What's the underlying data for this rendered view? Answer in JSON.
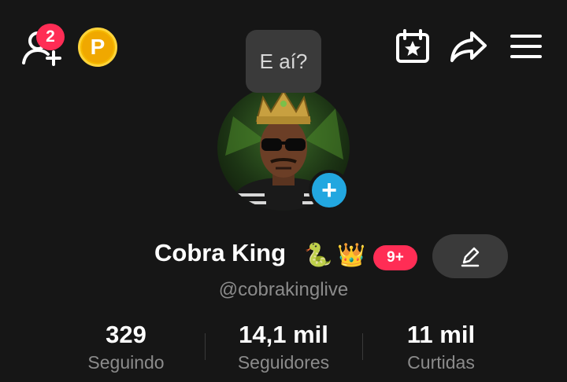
{
  "header": {
    "notifications_count": "2",
    "coin_label": "P",
    "icons": [
      "add-friend-icon",
      "coin-icon",
      "calendar-star-icon",
      "share-icon",
      "menu-icon"
    ],
    "colors": {
      "badge": "#ff2d55",
      "coin": "#f5b800",
      "accent": "#22a7e0",
      "background": "#161616"
    }
  },
  "profile": {
    "status_bubble": "E aí?",
    "display_name": "Cobra King",
    "name_emojis": [
      "🐍",
      "👑"
    ],
    "badge_count": "9+",
    "username": "@cobrakinglive"
  },
  "stats": [
    {
      "value": "329",
      "label": "Seguindo"
    },
    {
      "value": "14,1 mil",
      "label": "Seguidores"
    },
    {
      "value": "11 mil",
      "label": "Curtidas"
    }
  ]
}
